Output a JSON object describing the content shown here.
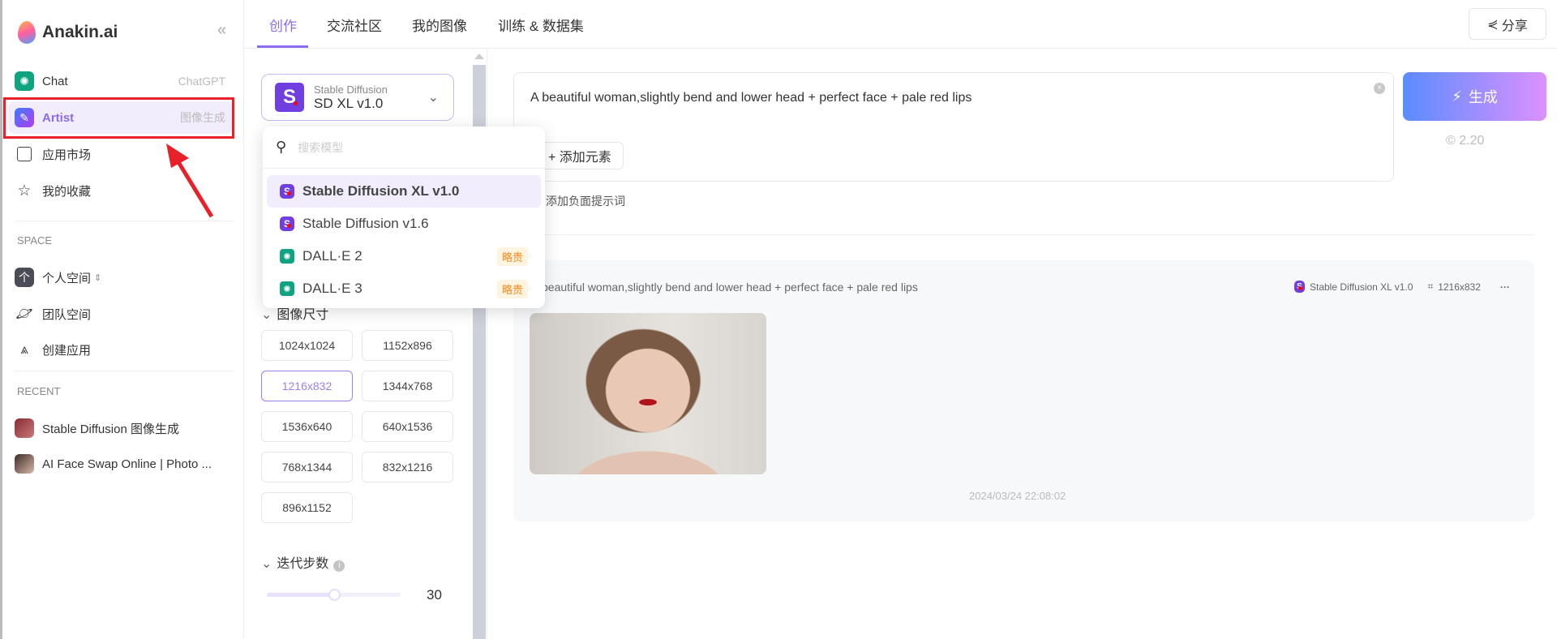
{
  "brand": {
    "name": "Anakin.ai"
  },
  "sidebar": {
    "items": [
      {
        "label": "Chat",
        "sub": "ChatGPT",
        "icon": "openai-icon"
      },
      {
        "label": "Artist",
        "sub": "图像生成",
        "icon": "artist-icon"
      },
      {
        "label": "应用市场",
        "icon": "store-icon"
      },
      {
        "label": "我的收藏",
        "icon": "star-icon"
      }
    ],
    "space_label": "SPACE",
    "space_items": [
      {
        "label": "个人空间",
        "icon": "personal-space-icon",
        "badge": "个"
      },
      {
        "label": "团队空间",
        "icon": "planet-icon"
      },
      {
        "label": "创建应用",
        "icon": "compass-icon"
      }
    ],
    "recent_label": "RECENT",
    "recent_items": [
      {
        "label": "Stable Diffusion 图像生成"
      },
      {
        "label": "AI Face Swap Online | Photo ..."
      }
    ]
  },
  "tabs": [
    {
      "label": "创作"
    },
    {
      "label": "交流社区"
    },
    {
      "label": "我的图像"
    },
    {
      "label": "训练 & 数据集"
    }
  ],
  "share_label": "分享",
  "model_select": {
    "family": "Stable Diffusion",
    "model": "SD XL v1.0",
    "badge": "S"
  },
  "dropdown": {
    "search_placeholder": "搜索模型",
    "items": [
      {
        "label": "Stable Diffusion XL v1.0",
        "type": "sd"
      },
      {
        "label": "Stable Diffusion v1.6",
        "type": "sd"
      },
      {
        "label": "DALL·E 2",
        "type": "openai",
        "tag": "略贵"
      },
      {
        "label": "DALL·E 3",
        "type": "openai",
        "tag": "略贵"
      }
    ]
  },
  "image_size": {
    "label": "图像尺寸",
    "options": [
      "1024x1024",
      "1152x896",
      "1216x832",
      "1344x768",
      "1536x640",
      "640x1536",
      "768x1344",
      "832x1216",
      "896x1152"
    ],
    "selected": "1216x832"
  },
  "steps": {
    "label": "迭代步数",
    "value": "30",
    "fraction": 0.5
  },
  "prompt": {
    "text": "A beautiful woman,slightly bend and lower head + perfect face + pale red lips",
    "add_element": "+ 添加元素",
    "negative": "添加负面提示词"
  },
  "generate": {
    "label": "生成",
    "cost": "2.20"
  },
  "result": {
    "prompt": "beautiful woman,slightly bend and lower head + perfect face + pale red lips",
    "model": "Stable Diffusion XL v1.0",
    "size": "1216x832",
    "more": "···",
    "timestamp": "2024/03/24 22:08:02"
  },
  "colors": {
    "accent": "#8b6cf0",
    "highlight": "#e8202a",
    "openai": "#10a37f",
    "sd": "#6f3fe0"
  }
}
